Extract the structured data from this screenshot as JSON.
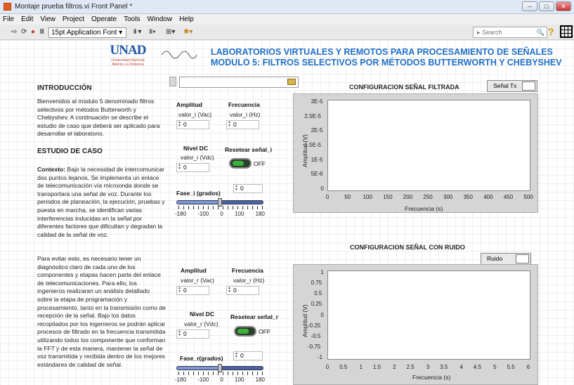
{
  "window": {
    "title": "Montaje prueba filtros.vi Front Panel *"
  },
  "menu": [
    "File",
    "Edit",
    "View",
    "Project",
    "Operate",
    "Tools",
    "Window",
    "Help"
  ],
  "toolbar": {
    "font": "15pt Application Font",
    "search_placeholder": "Search"
  },
  "header": {
    "line1": "LABORATORIOS VIRTUALES Y REMOTOS PARA PROCESAMIENTO DE SEÑALES",
    "line2": "MODULO 5: FILTROS SELECTIVOS POR MÉTODOS BUTTERWORTH Y CHEBYSHEV",
    "logo_text": "UNAD",
    "logo_sub": "Universidad Nacional Abierta y a Distancia"
  },
  "left": {
    "intro_title": "INTRODUCCIÓN",
    "intro_text": "Bienvenidos al modulo 5 denominado filtros selectivos por métodos Butterworth y Chebyshev. A continuación se describe el estudio de caso que deberá ser aplicado para desarrollar el laboratorio.",
    "case_title": "ESTUDIO DE CASO",
    "context_label": "Contexto:",
    "context_text": "Bajo la necesidad de intercomunicar dos puntos lejanos, Se implementa un enlace de telecomunicación vía microonda donde se transportara una señal de voz. Durante los periodos de planeación, la ejecución, pruebas y puesta en marcha, se identifican varias interferencias inducidas en la señal por diferentes factores que dificultan y degradan la calidad de la señal de voz.",
    "text2": "Para evitar esto, es necesario tener un diagnóstico claro de cada uno de los componentes y etapas hacen parte del enlace de telecomunicaciones. Para ello, los ingenieros realizaran un análisis detallado sobre la etapa de programación y procesamiento, tanto en la transmisión como de recepción de la señal. Bajo los datos recopilados por los ingenieros se podrán aplicar procesos de filtrado en la frecuencia transmitida utilizando todos los componente que conforman la FFT y de esta manera, mantener la señal de voz transmitida y recibida dentro de los mejores estándares de calidad de señal."
  },
  "controls_i": {
    "amplitud_label": "Amplitud",
    "amplitud_sub": "valor_i (Vac)",
    "amplitud_value": "0",
    "frecuencia_label": "Frecuencia",
    "frecuencia_sub": "valor_i (Hz)",
    "frecuencia_value": "0",
    "nivel_label": "Nivel DC",
    "nivel_sub": "valor_i (Vdc)",
    "nivel_value": "0",
    "reset_label": "Resetear señal_i",
    "reset_state": "OFF",
    "fase_label": "Fase_i (grados)",
    "fase_value": "0",
    "scale": [
      "-180",
      "-100",
      "0",
      "100",
      "180"
    ],
    "fase_level": 0.5
  },
  "controls_r": {
    "amplitud_label": "Amplitud",
    "amplitud_sub": "valor_r (Vac)",
    "amplitud_value": "0",
    "frecuencia_label": "Frecuencia",
    "frecuencia_sub": "valor_r (Hz)",
    "frecuencia_value": "0",
    "nivel_label": "Nivel DC",
    "nivel_sub": "valor_r (Vdc)",
    "nivel_value": "0",
    "reset_label": "Resetear señal_r",
    "reset_state": "OFF",
    "fase_label": "Fase_r(grados)",
    "fase_value": "0",
    "scale": [
      "-180",
      "-100",
      "0",
      "100",
      "180"
    ],
    "fase_level": 0.5
  },
  "graph1": {
    "title": "CONFIGURACION SEÑAL FILTRADA",
    "legend": "Señal Tx",
    "ylabel": "Amplitud (V)",
    "xlabel": "Frecuencia (s)",
    "yticks": [
      "3E-5",
      "2.5E-5",
      "2E-5",
      "1.5E-5",
      "1E-5",
      "5E-6",
      "0"
    ],
    "xticks": [
      "0",
      "50",
      "100",
      "150",
      "200",
      "250",
      "300",
      "350",
      "400",
      "450",
      "500"
    ]
  },
  "graph2": {
    "title": "CONFIGURACION SEÑAL CON RUIDO",
    "legend": "Ruido",
    "ylabel": "Amplitud (V)",
    "xlabel": "Frecuencia (s)",
    "yticks": [
      "1",
      "0.75",
      "0.5",
      "0.25",
      "0",
      "-0.25",
      "-0.5",
      "-0.75",
      "-1"
    ],
    "xticks": [
      "0",
      "0.5",
      "1",
      "1.5",
      "2",
      "2.5",
      "3",
      "3.5",
      "4",
      "4.5",
      "5",
      "5.5",
      "6"
    ]
  }
}
